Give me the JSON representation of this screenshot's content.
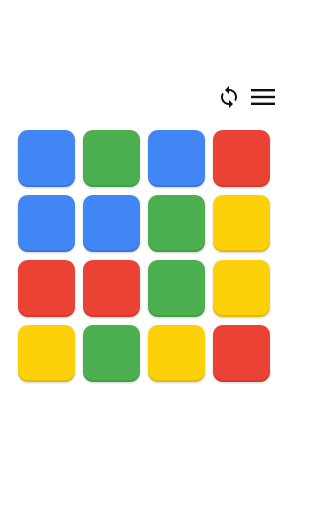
{
  "toolbar": {
    "refresh_icon": "refresh-icon",
    "menu_icon": "hamburger-menu-icon"
  },
  "colors": {
    "blue": "#4285F4",
    "green": "#4CAF50",
    "red": "#EA4335",
    "yellow": "#FDD10A"
  },
  "board": {
    "rows": 4,
    "cols": 4,
    "tiles": [
      [
        "blue",
        "green",
        "blue",
        "red"
      ],
      [
        "blue",
        "blue",
        "green",
        "yellow"
      ],
      [
        "red",
        "red",
        "green",
        "yellow"
      ],
      [
        "yellow",
        "green",
        "yellow",
        "red"
      ]
    ]
  }
}
